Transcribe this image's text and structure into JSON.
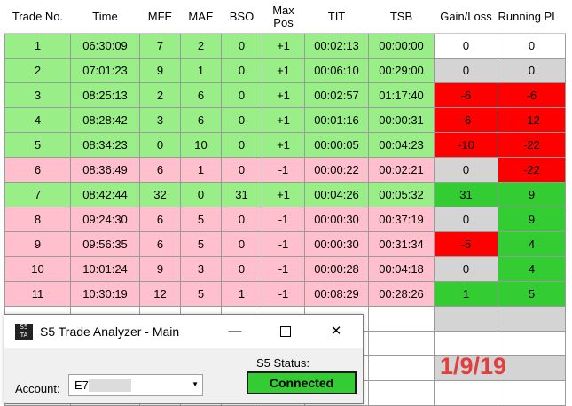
{
  "columns": [
    "Trade No.",
    "Time",
    "MFE",
    "MAE",
    "BSO",
    "Max\nPos",
    "TIT",
    "TSB",
    "Gain/Loss",
    "Running PL"
  ],
  "rows": [
    {
      "trade": "1",
      "time": "06:30:09",
      "mfe": "7",
      "mae": "2",
      "bso": "0",
      "maxpos": "+1",
      "tit": "00:02:13",
      "tsb": "00:00:00",
      "gain": "0",
      "running": "0",
      "side": "long",
      "gain_color": "white",
      "running_color": "white"
    },
    {
      "trade": "2",
      "time": "07:01:23",
      "mfe": "9",
      "mae": "1",
      "bso": "0",
      "maxpos": "+1",
      "tit": "00:06:10",
      "tsb": "00:29:00",
      "gain": "0",
      "running": "0",
      "side": "long",
      "gain_color": "gray",
      "running_color": "gray"
    },
    {
      "trade": "3",
      "time": "08:25:13",
      "mfe": "2",
      "mae": "6",
      "bso": "0",
      "maxpos": "+1",
      "tit": "00:02:57",
      "tsb": "01:17:40",
      "gain": "-6",
      "running": "-6",
      "side": "long",
      "gain_color": "red",
      "running_color": "red"
    },
    {
      "trade": "4",
      "time": "08:28:42",
      "mfe": "3",
      "mae": "6",
      "bso": "0",
      "maxpos": "+1",
      "tit": "00:01:16",
      "tsb": "00:00:31",
      "gain": "-6",
      "running": "-12",
      "side": "long",
      "gain_color": "red",
      "running_color": "red"
    },
    {
      "trade": "5",
      "time": "08:34:23",
      "mfe": "0",
      "mae": "10",
      "bso": "0",
      "maxpos": "+1",
      "tit": "00:00:05",
      "tsb": "00:04:23",
      "gain": "-10",
      "running": "-22",
      "side": "long",
      "gain_color": "red",
      "running_color": "red"
    },
    {
      "trade": "6",
      "time": "08:36:49",
      "mfe": "6",
      "mae": "1",
      "bso": "0",
      "maxpos": "-1",
      "tit": "00:00:22",
      "tsb": "00:02:21",
      "gain": "0",
      "running": "-22",
      "side": "short",
      "gain_color": "gray",
      "running_color": "red"
    },
    {
      "trade": "7",
      "time": "08:42:44",
      "mfe": "32",
      "mae": "0",
      "bso": "31",
      "maxpos": "+1",
      "tit": "00:04:26",
      "tsb": "00:05:32",
      "gain": "31",
      "running": "9",
      "side": "long",
      "gain_color": "green",
      "running_color": "green"
    },
    {
      "trade": "8",
      "time": "09:24:30",
      "mfe": "6",
      "mae": "5",
      "bso": "0",
      "maxpos": "-1",
      "tit": "00:00:30",
      "tsb": "00:37:19",
      "gain": "0",
      "running": "9",
      "side": "short",
      "gain_color": "gray",
      "running_color": "green"
    },
    {
      "trade": "9",
      "time": "09:56:35",
      "mfe": "6",
      "mae": "5",
      "bso": "0",
      "maxpos": "-1",
      "tit": "00:00:30",
      "tsb": "00:31:34",
      "gain": "-5",
      "running": "4",
      "side": "short",
      "gain_color": "red",
      "running_color": "green"
    },
    {
      "trade": "10",
      "time": "10:01:24",
      "mfe": "9",
      "mae": "3",
      "bso": "0",
      "maxpos": "-1",
      "tit": "00:00:28",
      "tsb": "00:04:18",
      "gain": "0",
      "running": "4",
      "side": "short",
      "gain_color": "gray",
      "running_color": "green"
    },
    {
      "trade": "11",
      "time": "10:30:19",
      "mfe": "12",
      "mae": "5",
      "bso": "1",
      "maxpos": "-1",
      "tit": "00:08:29",
      "tsb": "00:28:26",
      "gain": "1",
      "running": "5",
      "side": "short",
      "gain_color": "green",
      "running_color": "green"
    }
  ],
  "window": {
    "title": "S5 Trade Analyzer - Main",
    "logo_top": "S5",
    "logo_bottom": "TA",
    "minimize": "—",
    "close": "✕",
    "account_label": "Account:",
    "account_value": "E7",
    "status_label": "S5 Status:",
    "status_value": "Connected"
  },
  "date_stamp": "1/9/19",
  "colors": {
    "long_row": "#99ee88",
    "short_row": "#ffbfcc",
    "loss": "#ff0000",
    "gain": "#33cc33",
    "neutral": "#d4d4d4",
    "date_stamp": "#e04040"
  }
}
